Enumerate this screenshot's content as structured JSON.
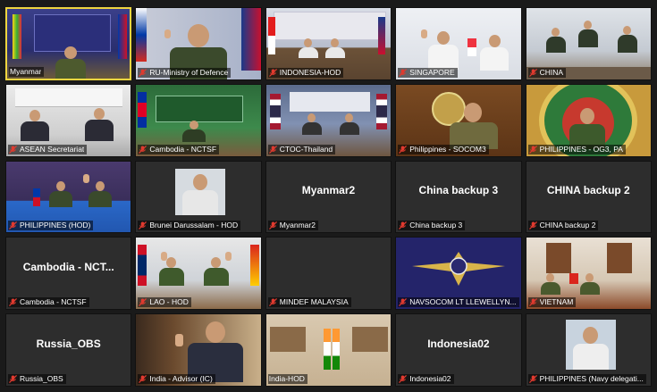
{
  "meeting": {
    "tiles": [
      {
        "label": "Myanmar",
        "active": true
      },
      {
        "label": "RU-Ministry of Defence"
      },
      {
        "label": "INDONESIA-HOD"
      },
      {
        "label": "SINGAPORE"
      },
      {
        "label": "CHINA"
      },
      {
        "label": "ASEAN Secretariat"
      },
      {
        "label": "Cambodia - NCTSF"
      },
      {
        "label": "CTOC-Thailand"
      },
      {
        "label": "Philippines - SOCOM3"
      },
      {
        "label": "PHILIPPINES - OG3, PA"
      },
      {
        "label": "PHILIPPINES (HOD)"
      },
      {
        "label": "Brunei Darussalam - HOD"
      },
      {
        "label": "Myanmar2",
        "center_name": "Myanmar2"
      },
      {
        "label": "China backup 3",
        "center_name": "China backup 3"
      },
      {
        "label": "CHINA backup 2",
        "center_name": "CHINA backup 2"
      },
      {
        "label": "Cambodia - NCTSF",
        "center_name": "Cambodia - NCT..."
      },
      {
        "label": "LAO - HOD"
      },
      {
        "label": "MINDEF MALAYSIA"
      },
      {
        "label": "NAVSOCOM LT LLEWELLYN..."
      },
      {
        "label": "VIETNAM"
      },
      {
        "label": "Russia_OBS",
        "center_name": "Russia_OBS"
      },
      {
        "label": "India - Advisor (IC)"
      },
      {
        "label": "India-HOD"
      },
      {
        "label": "Indonesia02",
        "center_name": "Indonesia02"
      },
      {
        "label": "PHILIPPINES (Navy delegati..."
      }
    ]
  },
  "colors": {
    "active_border": "#f0d640",
    "mic_muted": "#e03a2f",
    "tile_bg": "#2d2d2d",
    "window_bg": "#1a1a1a"
  },
  "icons": {
    "muted_mic": "mic-muted-icon",
    "hand": "hand-icon"
  }
}
